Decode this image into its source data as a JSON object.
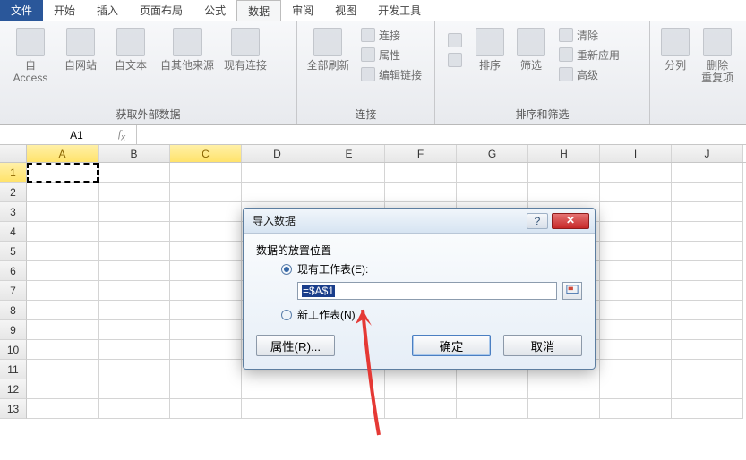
{
  "menu": {
    "file": "文件",
    "home": "开始",
    "insert": "插入",
    "page_layout": "页面布局",
    "formulas": "公式",
    "data": "数据",
    "review": "审阅",
    "view": "视图",
    "developer": "开发工具"
  },
  "ribbon": {
    "group_external_data": "获取外部数据",
    "from_access": "自 Access",
    "from_web": "自网站",
    "from_text": "自文本",
    "from_other": "自其他来源",
    "existing_conn": "现有连接",
    "group_connections": "连接",
    "refresh_all": "全部刷新",
    "connections": "连接",
    "properties": "属性",
    "edit_links": "编辑链接",
    "group_sort_filter": "排序和筛选",
    "sort": "排序",
    "filter": "筛选",
    "clear": "清除",
    "reapply": "重新应用",
    "advanced": "高级",
    "group_data_tools": "",
    "text_to_cols": "分列",
    "remove_dups1": "删除",
    "remove_dups2": "重复项"
  },
  "namebox": "A1",
  "formula": "",
  "columns": [
    "A",
    "B",
    "C",
    "D",
    "E",
    "F",
    "G",
    "H",
    "I",
    "J"
  ],
  "rows": [
    "1",
    "2",
    "3",
    "4",
    "5",
    "6",
    "7",
    "8",
    "9",
    "10",
    "11",
    "12",
    "13"
  ],
  "dialog": {
    "title": "导入数据",
    "heading": "数据的放置位置",
    "existing_sheet": "现有工作表(E):",
    "ref_value": "=$A$1",
    "new_sheet": "新工作表(N)",
    "properties": "属性(R)...",
    "ok": "确定",
    "cancel": "取消",
    "help": "?",
    "close": "✕"
  }
}
